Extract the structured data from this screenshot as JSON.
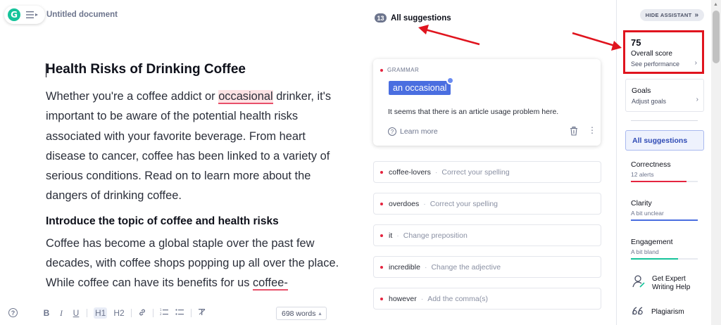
{
  "app": {
    "logo_letter": "G",
    "doc_title": "Untitled document"
  },
  "document": {
    "heading": "Health Risks of Drinking Coffee",
    "para1_a": "Whether you're a coffee addict or ",
    "para1_flag": "occasional",
    "para1_b": " drinker, it's important to be aware of the potential health risks associated with your favorite beverage. From heart disease to cancer, coffee has been linked to a variety of serious conditions. Read on to learn more about the dangers of drinking coffee.",
    "subheading": "Introduce the topic of coffee and health risks",
    "para2_a": "Coffee has become a global staple over the past few decades, with coffee shops popping up all over the place. While coffee can have its benefits for us ",
    "para2_flag": "coffee-"
  },
  "toolbar": {
    "help": "?",
    "bold": "B",
    "italic": "I",
    "underline": "U",
    "h1": "H1",
    "h2": "H2",
    "link": "🔗",
    "ol": "⋮≡",
    "ul": "•≡",
    "clear": "T̸",
    "word_count": "698 words",
    "word_count_caret": "▴"
  },
  "suggestions": {
    "count": "13",
    "title": "All suggestions",
    "expanded": {
      "category": "GRAMMAR",
      "replacement": "an occasional",
      "explanation": "It seems that there is an article usage problem here.",
      "learn_more": "Learn more"
    },
    "items": [
      {
        "word": "coffee-lovers",
        "sep": "·",
        "action": "Correct your spelling"
      },
      {
        "word": "overdoes",
        "sep": "·",
        "action": "Correct your spelling"
      },
      {
        "word": "it",
        "sep": "·",
        "action": "Change preposition"
      },
      {
        "word": "incredible",
        "sep": "·",
        "action": "Change the adjective"
      },
      {
        "word": "however",
        "sep": "·",
        "action": "Add the comma(s)"
      }
    ]
  },
  "sidebar": {
    "hide_label": "HIDE ASSISTANT",
    "hide_chevrons": "»",
    "score": "75",
    "score_label": "Overall score",
    "score_link": "See performance",
    "goals_title": "Goals",
    "goals_link": "Adjust goals",
    "all_suggestions": "All suggestions",
    "categories": [
      {
        "title": "Correctness",
        "sub": "12 alerts",
        "fill": 0.83,
        "color": "#e5243f"
      },
      {
        "title": "Clarity",
        "sub": "A bit unclear",
        "fill": 1.0,
        "color": "#4a6ee0"
      },
      {
        "title": "Engagement",
        "sub": "A bit bland",
        "fill": 0.7,
        "color": "#15c39a"
      }
    ],
    "expert_label_1": "Get Expert",
    "expert_label_2": "Writing Help",
    "plagiarism": "Plagiarism",
    "chevron": "›"
  },
  "colors": {
    "accent": "#4a6ee0",
    "alert": "#e5243f",
    "brand": "#15c39a",
    "annotation": "#e0141e"
  }
}
